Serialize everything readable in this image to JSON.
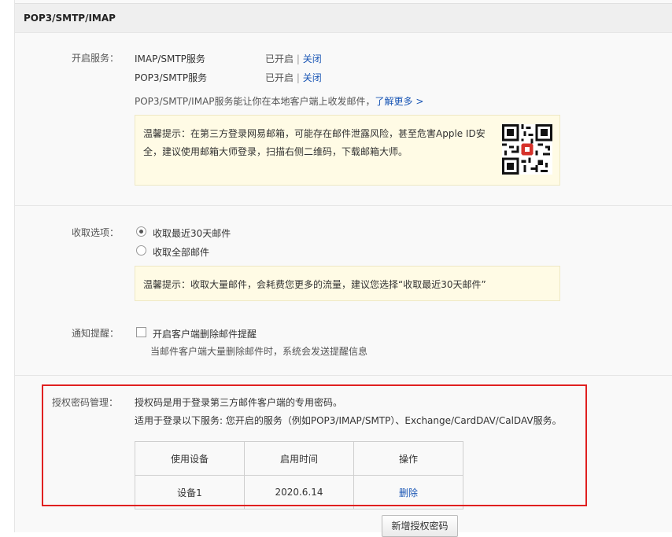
{
  "header": {
    "title": "POP3/SMTP/IMAP"
  },
  "services": {
    "label": "开启服务：",
    "items": [
      {
        "name": "IMAP/SMTP服务",
        "status": "已开启",
        "sep": "|",
        "action": "关闭"
      },
      {
        "name": "POP3/SMTP服务",
        "status": "已开启",
        "sep": "|",
        "action": "关闭"
      }
    ],
    "desc": "POP3/SMTP/IMAP服务能让你在本地客户端上收发邮件，",
    "learn_more": "了解更多 >",
    "tip_line1": "温馨提示：在第三方登录网易邮箱，可能存在邮件泄露风险，甚至危害Apple ID安",
    "tip_line2": "全，建议使用邮箱大师登录，扫描右侧二维码，下载邮箱大师。"
  },
  "fetch": {
    "label": "收取选项：",
    "options": [
      "收取最近30天邮件",
      "收取全部邮件"
    ],
    "selected": 0,
    "tip": "温馨提示：收取大量邮件，会耗费您更多的流量，建议您选择“收取最近30天邮件”"
  },
  "notify": {
    "label": "通知提醒：",
    "checkbox_label": "开启客户端删除邮件提醒",
    "hint": "当邮件客户端大量删除邮件时，系统会发送提醒信息"
  },
  "auth": {
    "label": "授权密码管理：",
    "line1": "授权码是用于登录第三方邮件客户端的专用密码。",
    "line2": "适用于登录以下服务: 您开启的服务（例如POP3/IMAP/SMTP）、Exchange/CardDAV/CalDAV服务。",
    "columns": [
      "使用设备",
      "启用时间",
      "操作"
    ],
    "rows": [
      {
        "device": "设备1",
        "date": "2020.6.14",
        "action": "删除"
      }
    ],
    "new_button": "新增授权密码"
  },
  "colors": {
    "link": "#1a56b5",
    "tip_bg": "#fffbe5",
    "highlight_border": "#e02020"
  }
}
